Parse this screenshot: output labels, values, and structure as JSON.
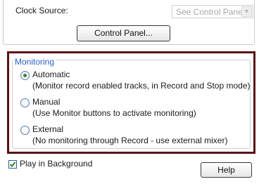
{
  "clock_source": {
    "label": "Clock Source:",
    "selected": "See Control Panel"
  },
  "control_panel_button": "Control Panel...",
  "monitoring": {
    "legend": "Monitoring",
    "options": [
      {
        "label": "Automatic",
        "desc": "(Monitor record enabled tracks, in Record and Stop mode)",
        "selected": true
      },
      {
        "label": "Manual",
        "desc": "(Use Monitor buttons to activate monitoring)",
        "selected": false
      },
      {
        "label": "External",
        "desc": "(No monitoring through Record - use external mixer)",
        "selected": false
      }
    ]
  },
  "play_in_background": {
    "label": "Play in Background",
    "checked": true
  },
  "help_button": "Help",
  "colors": {
    "highlight_border": "#5a1313",
    "legend_text": "#2b5fc7"
  }
}
